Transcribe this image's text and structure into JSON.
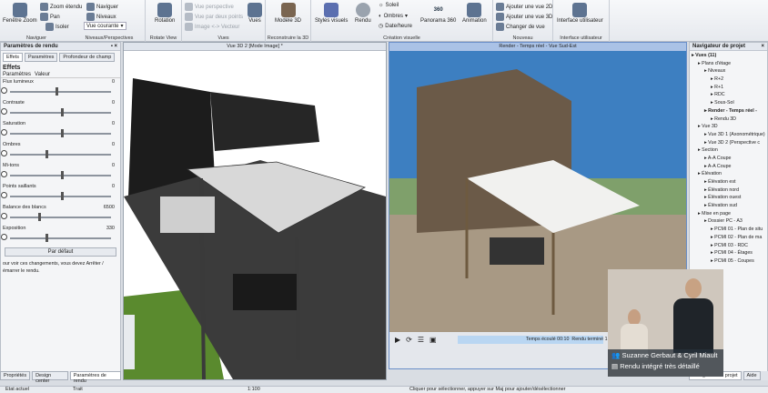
{
  "ribbon": {
    "navigator": {
      "title": "Naviguer",
      "zoom_window": "Fenêtre Zoom",
      "zoom_extent": "Zoom étendu",
      "pan": "Pan",
      "isolate": "Isoler",
      "navigate": "Naviguer",
      "levels": "Niveaux",
      "current_view": "Vue courante"
    },
    "levels_group": {
      "title": "Niveaux/Perspectives"
    },
    "rotate": {
      "label": "Rotation",
      "title": "Rotate View"
    },
    "views": {
      "perspective": "Vue perspective",
      "two_points": "Vue par deux points",
      "image_vector": "Image <-> Vecteur",
      "views": "Vues",
      "title": "Vues"
    },
    "rebuild": {
      "model3d": "Modèle 3D",
      "title": "Reconstruire la 3D"
    },
    "visual": {
      "styles": "Styles visuels",
      "render": "Rendu",
      "sun": "Soleil",
      "shadows": "Ombres",
      "date_time": "Date/heure",
      "panorama": "Panorama 360",
      "animation": "Animation",
      "panorama_badge": "360",
      "title": "Création visuelle"
    },
    "new": {
      "add_2d": "Ajouter une vue 2D",
      "add_3d": "Ajouter une vue 3D",
      "change": "Changer de vue",
      "title": "Nouveau"
    },
    "ui": {
      "label": "Interface utilisateur",
      "title": "Interface utilisateur"
    }
  },
  "render_params": {
    "title": "Paramètres de rendu",
    "tabs": [
      "Effets",
      "Paramètres",
      "Profondeur de champ"
    ],
    "section": "Effets",
    "cols": [
      "Paramètres",
      "Valeur"
    ],
    "sliders": [
      {
        "label": "Flux lumineux",
        "value": "0",
        "pos": 0.45
      },
      {
        "label": "Contraste",
        "value": "0",
        "pos": 0.5
      },
      {
        "label": "Saturation",
        "value": "0",
        "pos": 0.5
      },
      {
        "label": "Ombres",
        "value": "0",
        "pos": 0.35
      },
      {
        "label": "Mi-tons",
        "value": "0",
        "pos": 0.5
      },
      {
        "label": "Points saillants",
        "value": "0",
        "pos": 0.5
      },
      {
        "label": "Balance des blancs",
        "value": "6500",
        "pos": 0.28
      },
      {
        "label": "Exposition",
        "value": "330",
        "pos": 0.35
      }
    ],
    "default_btn": "Par défaut",
    "hint_line1": "our voir ces changements, vous devez Arrêter /",
    "hint_line2": "émarrer le rendu."
  },
  "bottom_tabs": [
    "Propriétés",
    "Design center",
    "Paramètres de rendu"
  ],
  "view3d": {
    "title": "Vue 3D 2 [Mode Image] *"
  },
  "render_view": {
    "title": "Render - Temps réel - Vue Sud-Est",
    "elapsed": "Temps écoulé 00:10",
    "done": "Rendu terminé 1"
  },
  "navigator": {
    "title": "Navigateur de projet",
    "items": [
      {
        "t": "Vues (11)",
        "d": 0,
        "b": true
      },
      {
        "t": "Plans d'étage",
        "d": 1
      },
      {
        "t": "Niveaux",
        "d": 2
      },
      {
        "t": "R+2",
        "d": 3
      },
      {
        "t": "R+1",
        "d": 3
      },
      {
        "t": "RDC",
        "d": 3
      },
      {
        "t": "Sous-Sol",
        "d": 3
      },
      {
        "t": "Render - Temps réel -",
        "d": 2,
        "b": true
      },
      {
        "t": "Rendu 3D",
        "d": 3
      },
      {
        "t": "Vue 3D",
        "d": 1
      },
      {
        "t": "Vue 3D 1 (Axonométrique)",
        "d": 2
      },
      {
        "t": "Vue 3D 2 (Perspective c",
        "d": 2
      },
      {
        "t": "Section",
        "d": 1
      },
      {
        "t": "A-A Coupe",
        "d": 2
      },
      {
        "t": "A-A Coupe",
        "d": 2
      },
      {
        "t": "Élévation",
        "d": 1
      },
      {
        "t": "Élévation est",
        "d": 2
      },
      {
        "t": "Élévation nord",
        "d": 2
      },
      {
        "t": "Élévation ouest",
        "d": 2
      },
      {
        "t": "Élévation sud",
        "d": 2
      },
      {
        "t": "Mise en page",
        "d": 1
      },
      {
        "t": "Dossier PC - A3",
        "d": 2
      },
      {
        "t": "PCMI 01 - Plan de situ",
        "d": 3
      },
      {
        "t": "PCMI 02 - Plan de ma",
        "d": 3
      },
      {
        "t": "PCMI 03 - RDC",
        "d": 3
      },
      {
        "t": "PCMI 04 - Étages",
        "d": 3
      },
      {
        "t": "PCMI 05 - Coupes",
        "d": 3
      }
    ],
    "bottom_tabs": [
      "Navigateur de projet",
      "Aide"
    ]
  },
  "webcam": {
    "names": "Suzanne Gerbaut & Cyril Miault",
    "caption": "Rendu intégré très détaillé"
  },
  "status": {
    "state": "Etat actuel",
    "trait": "Trait",
    "scale": "1:100",
    "hint": "Cliquer pour sélectionner, appuyer sur Maj pour ajouter/désélectionner"
  }
}
